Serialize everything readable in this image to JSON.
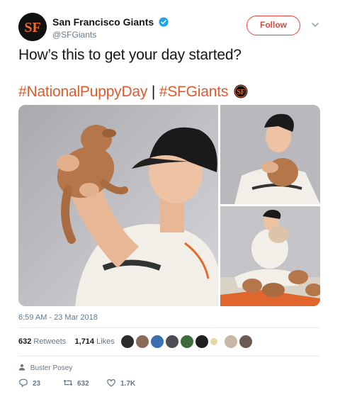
{
  "account": {
    "name": "San Francisco Giants",
    "handle": "@SFGiants",
    "follow_label": "Follow",
    "brand_color": "#e05a2b",
    "verified_color": "#1da1f2"
  },
  "tweet": {
    "text": "How’s this to get your day started?",
    "hashtag1": "#NationalPuppyDay",
    "separator": " | ",
    "hashtag2": "#SFGiants"
  },
  "media": {
    "photos": [
      "player-lifting-puppy",
      "player-hugging-puppy",
      "player-with-puppies-on-blanket"
    ]
  },
  "timestamp": "6:59 AM - 23 Mar 2018",
  "stats": {
    "retweets_count": "632",
    "retweets_label": "Retweets",
    "likes_count": "1,714",
    "likes_label": "Likes",
    "liker_avatar_count": 10
  },
  "context": {
    "label": "Buster Posey",
    "icon": "person-icon"
  },
  "actions": {
    "reply_count": "23",
    "retweet_count": "632",
    "like_count": "1.7K"
  }
}
